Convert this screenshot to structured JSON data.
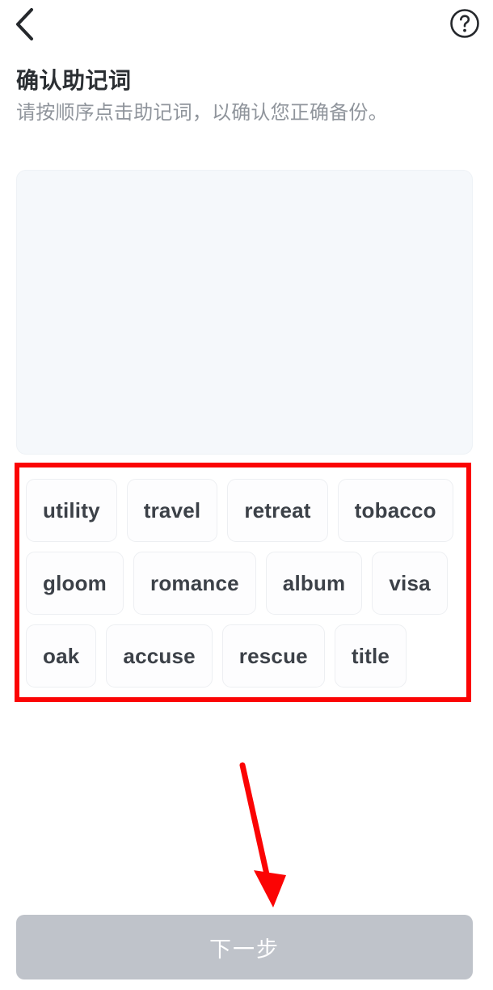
{
  "topbar": {
    "back_icon": "chevron-left-icon",
    "help_icon": "question-mark-circle-icon"
  },
  "heading": {
    "title": "确认助记词",
    "subtitle": "请按顺序点击助记词，以确认您正确备份。"
  },
  "answer_panel": {
    "selected_words": [],
    "fill_color": "#f5f8fb"
  },
  "word_bank": {
    "highlight_color": "#fb0404",
    "rows": [
      [
        "utility",
        "travel",
        "retreat",
        "tobacco"
      ],
      [
        "gloom",
        "romance",
        "album",
        "visa"
      ],
      [
        "oak",
        "accuse",
        "rescue",
        "title"
      ]
    ],
    "words": [
      "utility",
      "travel",
      "retreat",
      "tobacco",
      "gloom",
      "romance",
      "album",
      "visa",
      "oak",
      "accuse",
      "rescue",
      "title"
    ]
  },
  "annotation": {
    "arrow_color": "#fb0404",
    "arrow_points_to": "next-button"
  },
  "footer": {
    "next_label": "下一步",
    "next_enabled": false,
    "next_bg": "#bfc3ca",
    "next_text_color": "#ffffff"
  }
}
